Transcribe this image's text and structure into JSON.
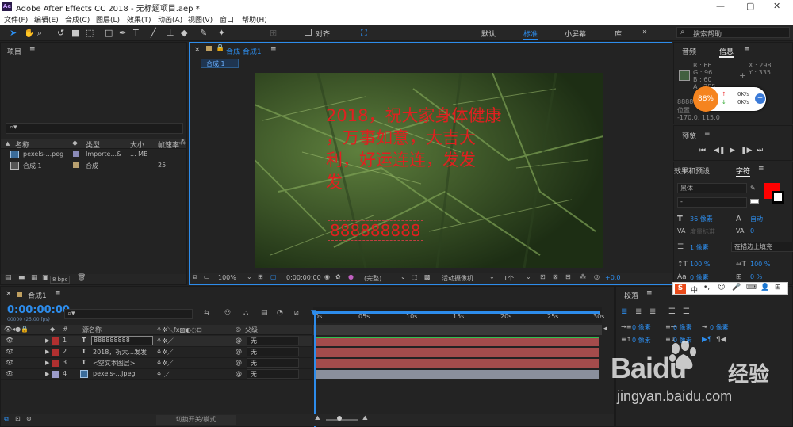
{
  "window": {
    "title": "Adobe After Effects CC 2018 - 无标题项目.aep *",
    "logo": "Ae",
    "controls": [
      "—",
      "▢",
      "✕"
    ]
  },
  "menu": [
    "文件(F)",
    "编辑(E)",
    "合成(C)",
    "图层(L)",
    "效果(T)",
    "动画(A)",
    "视图(V)",
    "窗口",
    "帮助(H)"
  ],
  "toolbar": {
    "align_label": "对齐",
    "workspaces": [
      "默认",
      "标准",
      "小屏幕",
      "库"
    ],
    "active_workspace": "标准",
    "search_placeholder": "搜索帮助"
  },
  "project": {
    "title": "项目",
    "search_placeholder": "",
    "columns": [
      "名称",
      "类型",
      "大小",
      "帧速率"
    ],
    "items": [
      {
        "name": "pexels-...peg",
        "type": "Importe...&",
        "size": "... MB",
        "fps": ""
      },
      {
        "name": "合成 1",
        "type": "合成",
        "size": "",
        "fps": "25"
      }
    ],
    "bpc": "8 bpc"
  },
  "comp": {
    "panel_title": "合成 合成1",
    "tab": "合成 1",
    "overlay_text": "2018，祝大家身体健康，万事如意，大吉大利，好运连连，发发发",
    "overlay_lines": [
      "2018，祝大家身体健康",
      "，万事如意，大吉大",
      "利，好运连连，发发",
      "发"
    ],
    "number_text": "888888888",
    "footer": {
      "zoom": "100%",
      "time": "0:00:00:00",
      "quality": "(完整)",
      "camera": "活动摄像机",
      "views": "1个...",
      "offset": "+0.0"
    }
  },
  "info": {
    "tabs": [
      "音频",
      "信息"
    ],
    "active_tab": "信息",
    "r": "R : 66",
    "g": "G : 96",
    "b": "B : 60",
    "a": "A : 255",
    "x": "X : 298",
    "y": "Y : 335",
    "pos_label": "位置",
    "pos_value": "-170.0, 115.0",
    "numbers": "8888",
    "color": "#426040",
    "badge": "88%",
    "net_up": "0K/s",
    "net_down": "0K/s"
  },
  "preview": {
    "title": "预览"
  },
  "character": {
    "tabs": [
      "效果和预设",
      "字符"
    ],
    "active_tab": "字符",
    "font": "黑体",
    "style": "-",
    "size": "36 像素",
    "leading": "自动",
    "kerning": "度量标准",
    "tracking": "0",
    "stroke": "1 像素",
    "stroke_type": "在描边上填充",
    "vscale": "100 %",
    "hscale": "100 %",
    "baseline": "0 像素",
    "tsume": "0 %",
    "fill_color": "#ff0000"
  },
  "paragraph": {
    "title": "段落",
    "indent_left": "0 像素",
    "indent_first": "0 像素",
    "indent_right": "0 像素",
    "space_before": "0 像素",
    "space_after": "0 像素"
  },
  "timeline": {
    "tab": "合成1",
    "timecode": "0:00:00:00",
    "fps_sub": "00000 (25.00 fps)",
    "columns": [
      "源名称",
      "父级"
    ],
    "ticks": [
      "0s",
      "05s",
      "10s",
      "15s",
      "20s",
      "25s",
      "30s"
    ],
    "layers": [
      {
        "num": "1",
        "type": "T",
        "name": "888888888",
        "parent": "无",
        "color": "#b03030",
        "bar": "#a44c4c"
      },
      {
        "num": "2",
        "type": "T",
        "name": "2018，祝大...发发",
        "parent": "无",
        "color": "#b03030",
        "bar": "#a44c4c"
      },
      {
        "num": "3",
        "type": "T",
        "name": "<空文本图层>",
        "parent": "无",
        "color": "#b03030",
        "bar": "#a44c4c"
      },
      {
        "num": "4",
        "type": "img",
        "name": "pexels-...jpeg",
        "parent": "无",
        "color": "#9a9ac8",
        "bar": "#8a8f9c"
      }
    ],
    "footer": "切换开关/模式"
  },
  "watermark": {
    "brand": "Baidu",
    "cn": "经验",
    "url": "jingyan.baidu.com"
  },
  "ime": {
    "label": "中"
  }
}
